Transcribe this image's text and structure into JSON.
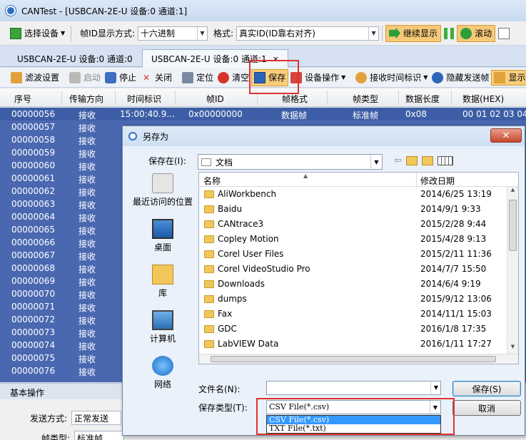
{
  "window": {
    "title": "CANTest  - [USBCAN-2E-U 设备:0 通道:1]"
  },
  "toolbar1": {
    "select_device": "选择设备",
    "id_format_label": "帧ID显示方式:",
    "id_format_value": "十六进制",
    "format_label": "格式:",
    "format_value": "真实ID(ID靠右对齐)",
    "continue_display": "继续显示",
    "scroll": "滚动"
  },
  "tabs": [
    {
      "label": "USBCAN-2E-U 设备:0 通道:0"
    },
    {
      "label": "USBCAN-2E-U 设备:0 通道:1",
      "close": "×"
    }
  ],
  "toolbar2": {
    "filter_settings": "滤波设置",
    "start": "启动",
    "stop": "停止",
    "close": "关闭",
    "locate": "定位",
    "clear": "清空",
    "save": "保存",
    "device_ops": "设备操作",
    "receive_timestamp": "接收时间标识",
    "hide_send_frames": "隐藏发送帧",
    "display": "显示"
  },
  "grid": {
    "headers": [
      "序号",
      "传输方向",
      "时间标识",
      "帧ID",
      "帧格式",
      "帧类型",
      "数据长度",
      "数据(HEX)"
    ],
    "first_row": {
      "seq": "00000056",
      "dir": "接收",
      "time": "15:00:40.9...",
      "id": "0x00000000",
      "format": "数据帧",
      "type": "标准帧",
      "len": "0x08",
      "data": "00 01 02 03 04"
    },
    "rows": [
      {
        "seq": "00000057",
        "dir": "接收"
      },
      {
        "seq": "00000058",
        "dir": "接收"
      },
      {
        "seq": "00000059",
        "dir": "接收"
      },
      {
        "seq": "00000060",
        "dir": "接收"
      },
      {
        "seq": "00000061",
        "dir": "接收"
      },
      {
        "seq": "00000062",
        "dir": "接收"
      },
      {
        "seq": "00000063",
        "dir": "接收"
      },
      {
        "seq": "00000064",
        "dir": "接收"
      },
      {
        "seq": "00000065",
        "dir": "接收"
      },
      {
        "seq": "00000066",
        "dir": "接收"
      },
      {
        "seq": "00000067",
        "dir": "接收"
      },
      {
        "seq": "00000068",
        "dir": "接收"
      },
      {
        "seq": "00000069",
        "dir": "接收"
      },
      {
        "seq": "00000070",
        "dir": "接收"
      },
      {
        "seq": "00000071",
        "dir": "接收"
      },
      {
        "seq": "00000072",
        "dir": "接收"
      },
      {
        "seq": "00000073",
        "dir": "接收"
      },
      {
        "seq": "00000074",
        "dir": "接收"
      },
      {
        "seq": "00000075",
        "dir": "接收"
      },
      {
        "seq": "00000076",
        "dir": "接收"
      }
    ]
  },
  "basic": {
    "section_title": "基本操作",
    "send_mode_label": "发送方式:",
    "send_mode_value": "正常发送",
    "frame_type_label": "帧类型:",
    "frame_type_value": "标准帧"
  },
  "dialog": {
    "title": "另存为",
    "close": "✕",
    "save_in_label": "保存在(I):",
    "location": "文档",
    "places": [
      {
        "label": "最近访问的位置"
      },
      {
        "label": "桌面"
      },
      {
        "label": "库"
      },
      {
        "label": "计算机"
      },
      {
        "label": "网络"
      }
    ],
    "col_name": "名称",
    "col_date": "修改日期",
    "files": [
      {
        "name": "AliWorkbench",
        "date": "2014/6/25 13:19"
      },
      {
        "name": "Baidu",
        "date": "2014/9/1 9:33"
      },
      {
        "name": "CANtrace3",
        "date": "2015/2/28 9:44"
      },
      {
        "name": "Copley Motion",
        "date": "2015/4/28 9:13"
      },
      {
        "name": "Corel User Files",
        "date": "2015/2/11 11:36"
      },
      {
        "name": "Corel VideoStudio Pro",
        "date": "2014/7/7 15:50"
      },
      {
        "name": "Downloads",
        "date": "2014/6/4 9:19"
      },
      {
        "name": "dumps",
        "date": "2015/9/12 13:06"
      },
      {
        "name": "Fax",
        "date": "2014/11/1 15:03"
      },
      {
        "name": "GDC",
        "date": "2016/1/8 17:35"
      },
      {
        "name": "LabVIEW Data",
        "date": "2016/1/11 17:27"
      }
    ],
    "filename_label": "文件名(N):",
    "filename_value": "",
    "filetype_label": "保存类型(T):",
    "filetype_value": "CSV File(*.csv)",
    "filetype_options": [
      "CSV File(*.csv)",
      "TXT File(*.txt)"
    ],
    "save_button": "保存(S)",
    "cancel_button": "取消"
  }
}
